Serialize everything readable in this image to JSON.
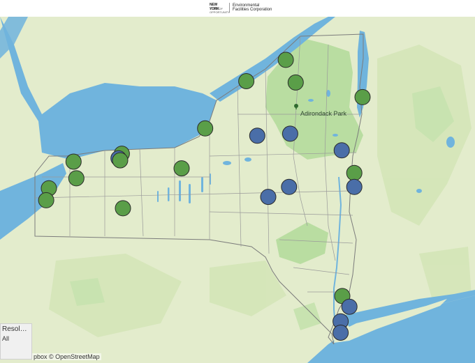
{
  "header": {
    "logo_state": "NEW YORK",
    "logo_state_sub": "STATE OF OPPORTUNITY.",
    "logo_org_line1": "Environmental",
    "logo_org_line2": "Facilities Corporation"
  },
  "map": {
    "park_label": "Adirondack Park",
    "colors": {
      "land": "#e3eccc",
      "water": "#70b4dd",
      "park": "#b9dda1",
      "forest": "#c8e3b0",
      "border": "#7b7b7b",
      "green_marker": "#5a9e48",
      "blue_marker": "#4a6ea8",
      "marker_stroke": "#2b2b2b"
    },
    "markers": [
      {
        "category": "green",
        "lon": -74.88,
        "lat": 44.98
      },
      {
        "category": "green",
        "lon": -75.6,
        "lat": 44.66
      },
      {
        "category": "green",
        "lon": -74.7,
        "lat": 44.64
      },
      {
        "category": "green",
        "lon": -73.48,
        "lat": 44.42
      },
      {
        "category": "green",
        "lon": -76.35,
        "lat": 43.95
      },
      {
        "category": "blue",
        "lon": -75.4,
        "lat": 43.84
      },
      {
        "category": "blue",
        "lon": -74.8,
        "lat": 43.87
      },
      {
        "category": "blue",
        "lon": -73.86,
        "lat": 43.62
      },
      {
        "category": "green",
        "lon": -77.87,
        "lat": 43.57
      },
      {
        "category": "blue",
        "lon": -77.93,
        "lat": 43.5
      },
      {
        "category": "green",
        "lon": -77.9,
        "lat": 43.47
      },
      {
        "category": "green",
        "lon": -78.75,
        "lat": 43.45
      },
      {
        "category": "green",
        "lon": -76.78,
        "lat": 43.35
      },
      {
        "category": "green",
        "lon": -73.63,
        "lat": 43.28
      },
      {
        "category": "green",
        "lon": -78.7,
        "lat": 43.2
      },
      {
        "category": "blue",
        "lon": -73.63,
        "lat": 43.07
      },
      {
        "category": "blue",
        "lon": -74.82,
        "lat": 43.07
      },
      {
        "category": "green",
        "lon": -79.2,
        "lat": 43.05
      },
      {
        "category": "blue",
        "lon": -75.2,
        "lat": 42.92
      },
      {
        "category": "green",
        "lon": -79.25,
        "lat": 42.87
      },
      {
        "category": "green",
        "lon": -77.85,
        "lat": 42.75
      },
      {
        "category": "green",
        "lon": -73.85,
        "lat": 41.43
      },
      {
        "category": "blue",
        "lon": -73.72,
        "lat": 41.27
      },
      {
        "category": "blue",
        "lon": -73.88,
        "lat": 41.05
      },
      {
        "category": "blue",
        "lon": -73.88,
        "lat": 40.88
      }
    ]
  },
  "resolution": {
    "label": "Resolutio...",
    "value": "All"
  },
  "attribution": "pbox © OpenStreetMap"
}
